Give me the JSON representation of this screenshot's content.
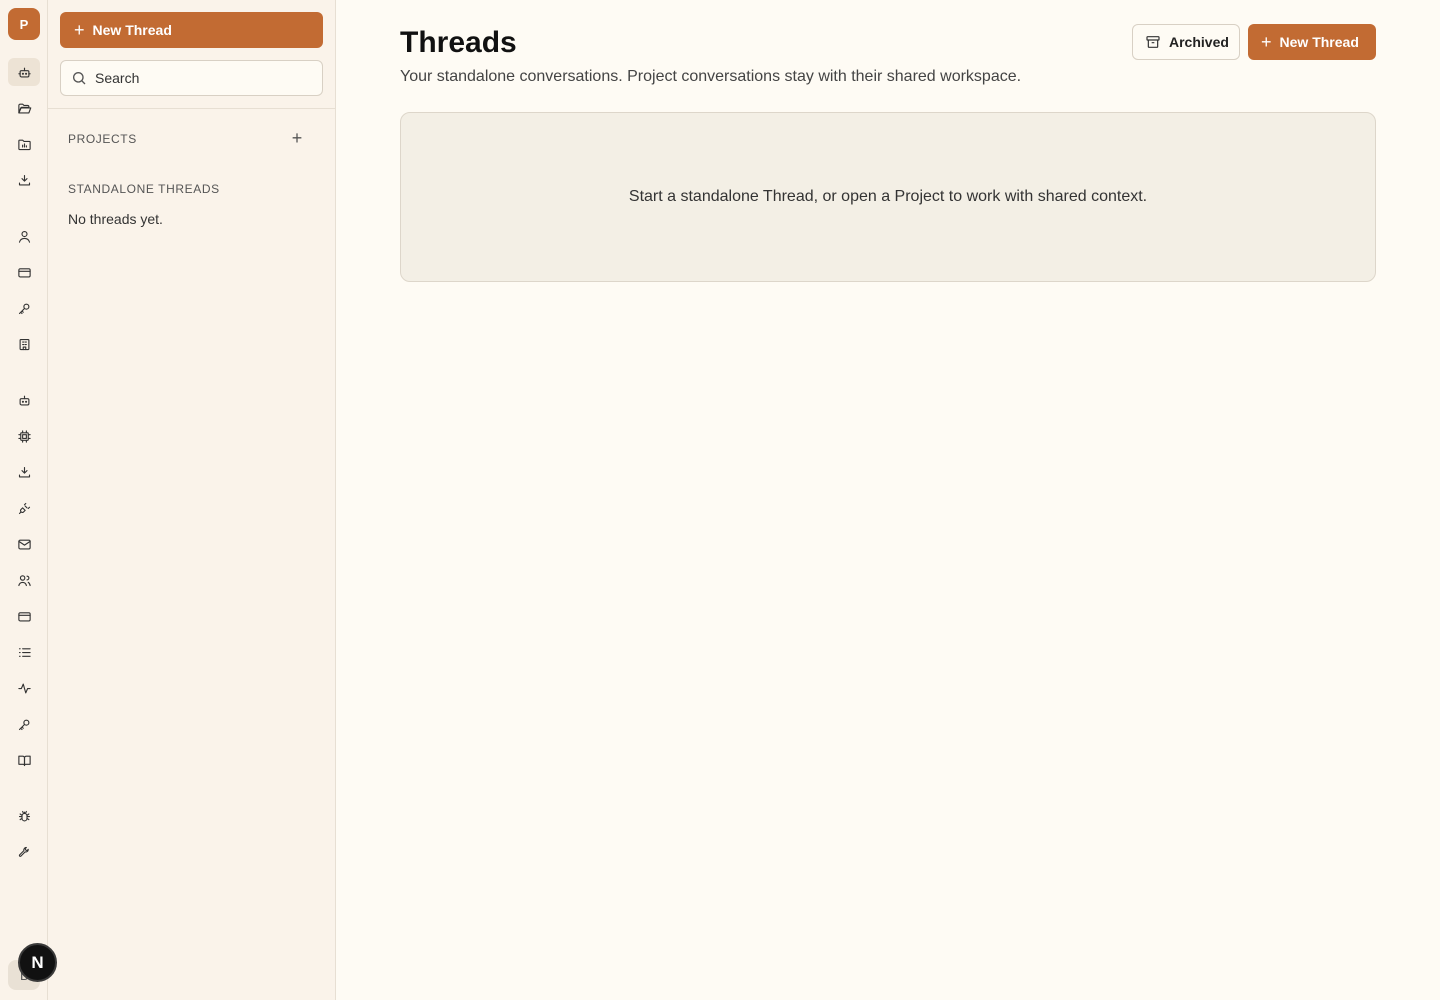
{
  "rail": {
    "avatar_letter": "P",
    "icons": [
      {
        "name": "bot-icon",
        "active": true
      },
      {
        "name": "folder-open-icon"
      },
      {
        "name": "folder-chart-icon"
      },
      {
        "name": "download-tray-icon"
      },
      {
        "name": "user-icon"
      },
      {
        "name": "credit-card-icon"
      },
      {
        "name": "key-icon"
      },
      {
        "name": "building-icon"
      },
      {
        "name": "bot-icon"
      },
      {
        "name": "cpu-chip-icon"
      },
      {
        "name": "download-tray-icon"
      },
      {
        "name": "plug-icon"
      },
      {
        "name": "mail-icon"
      },
      {
        "name": "users-icon"
      },
      {
        "name": "credit-card-icon"
      },
      {
        "name": "list-icon"
      },
      {
        "name": "activity-icon"
      },
      {
        "name": "key-icon"
      },
      {
        "name": "book-open-icon"
      },
      {
        "name": "bug-icon"
      },
      {
        "name": "wrench-icon"
      }
    ],
    "user_letter": "D",
    "badge_letter": "N"
  },
  "sidebar": {
    "new_thread_label": "New Thread",
    "search_placeholder": "Search",
    "projects_title": "PROJECTS",
    "projects_add": "+",
    "standalone_title": "STANDALONE THREADS",
    "empty_text": "No threads yet."
  },
  "main": {
    "title": "Threads",
    "subtitle": "Your standalone conversations. Project conversations stay with their shared workspace.",
    "archived_label": "Archived",
    "new_thread_label": "New Thread",
    "empty_message": "Start a standalone Thread, or open a Project to work with shared context."
  },
  "colors": {
    "accent": "#c26b33",
    "background": "#fefbf4",
    "sidebar_bg": "#faf3ea"
  }
}
